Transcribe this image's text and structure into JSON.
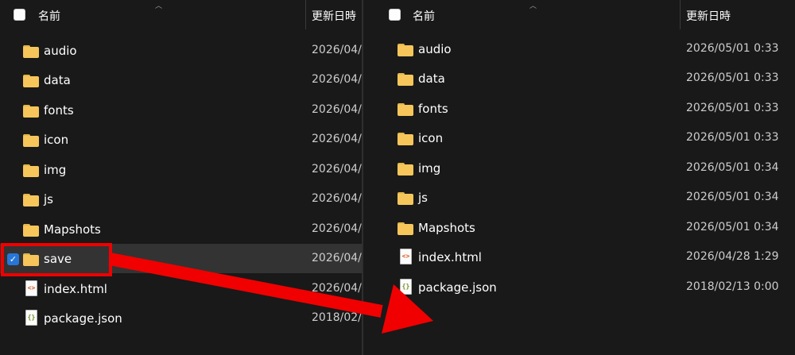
{
  "header": {
    "name_label": "名前",
    "date_label": "更新日時",
    "sort_glyph": "︿"
  },
  "left_pane": {
    "items": [
      {
        "name": "audio",
        "date": "2026/04/",
        "type": "folder"
      },
      {
        "name": "data",
        "date": "2026/04/",
        "type": "folder"
      },
      {
        "name": "fonts",
        "date": "2026/04/",
        "type": "folder"
      },
      {
        "name": "icon",
        "date": "2026/04/",
        "type": "folder"
      },
      {
        "name": "img",
        "date": "2026/04/",
        "type": "folder"
      },
      {
        "name": "js",
        "date": "2026/04/",
        "type": "folder"
      },
      {
        "name": "Mapshots",
        "date": "2026/04/",
        "type": "folder"
      },
      {
        "name": "save",
        "date": "2026/04/",
        "type": "folder",
        "selected": true
      },
      {
        "name": "index.html",
        "date": "2026/04/",
        "type": "html"
      },
      {
        "name": "package.json",
        "date": "2018/02/",
        "type": "json"
      }
    ]
  },
  "right_pane": {
    "items": [
      {
        "name": "audio",
        "date": "2026/05/01 0:33",
        "type": "folder"
      },
      {
        "name": "data",
        "date": "2026/05/01 0:33",
        "type": "folder"
      },
      {
        "name": "fonts",
        "date": "2026/05/01 0:33",
        "type": "folder"
      },
      {
        "name": "icon",
        "date": "2026/05/01 0:33",
        "type": "folder"
      },
      {
        "name": "img",
        "date": "2026/05/01 0:34",
        "type": "folder"
      },
      {
        "name": "js",
        "date": "2026/05/01 0:34",
        "type": "folder"
      },
      {
        "name": "Mapshots",
        "date": "2026/05/01 0:34",
        "type": "folder"
      },
      {
        "name": "index.html",
        "date": "2026/04/28 1:29",
        "type": "html"
      },
      {
        "name": "package.json",
        "date": "2018/02/13 0:00",
        "type": "json"
      }
    ]
  },
  "icons": {
    "html_glyph": "<>",
    "json_glyph": "{}",
    "check_glyph": "✓"
  },
  "annotation": {
    "color": "#f00000"
  }
}
